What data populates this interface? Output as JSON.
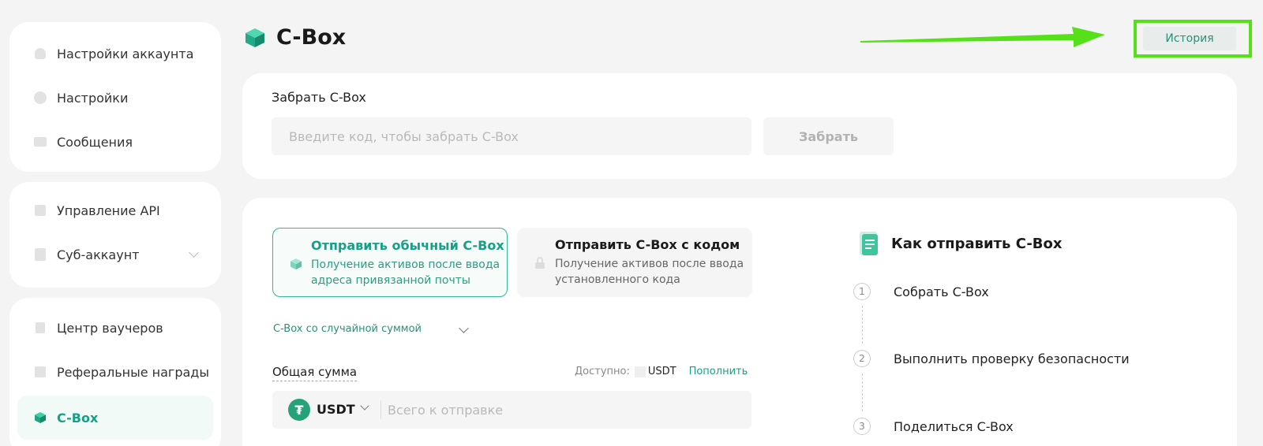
{
  "sidebar": {
    "groups": [
      {
        "items": [
          {
            "label": "Настройки аккаунта",
            "icon": "user-icon"
          },
          {
            "label": "Настройки",
            "icon": "pie-icon"
          },
          {
            "label": "Сообщения",
            "icon": "message-icon"
          }
        ]
      },
      {
        "items": [
          {
            "label": "Управление API",
            "icon": "api-icon"
          },
          {
            "label": "Суб-аккаунт",
            "icon": "subaccount-icon"
          }
        ]
      },
      {
        "items": [
          {
            "label": "Центр ваучеров",
            "icon": "voucher-icon"
          },
          {
            "label": "Реферальные награды",
            "icon": "referral-icon"
          },
          {
            "label": "C-Box",
            "icon": "cbox-icon",
            "active": true
          }
        ]
      }
    ]
  },
  "header": {
    "title": "C-Box",
    "history_label": "История"
  },
  "claim": {
    "label": "Забрать C-Box",
    "placeholder": "Введите код, чтобы забрать C-Box",
    "button": "Забрать"
  },
  "send": {
    "options": [
      {
        "title": "Отправить обычный C-Box",
        "desc1": "Получение активов после ввода",
        "desc2": "адреса привязанной почты"
      },
      {
        "title": "Отправить C-Box с кодом",
        "desc1": "Получение активов после ввода",
        "desc2": "установленного кода"
      }
    ],
    "mode": "C-Box со случайной суммой",
    "total_label": "Общая сумма",
    "available_label": "Доступно:",
    "available_currency": "USDT",
    "deposit_label": "Пополнить",
    "coin": "USDT",
    "coin_symbol": "₮",
    "amount_placeholder": "Всего к отправке"
  },
  "howto": {
    "title": "Как отправить C-Box",
    "steps": [
      {
        "num": "1",
        "text": "Собрать C-Box"
      },
      {
        "num": "2",
        "text": "Выполнить проверку безопасности"
      },
      {
        "num": "3",
        "text": "Поделиться C-Box"
      }
    ]
  },
  "colors": {
    "accent": "#16a085",
    "highlight_frame": "#55e01a",
    "background": "#f4f4f4"
  }
}
